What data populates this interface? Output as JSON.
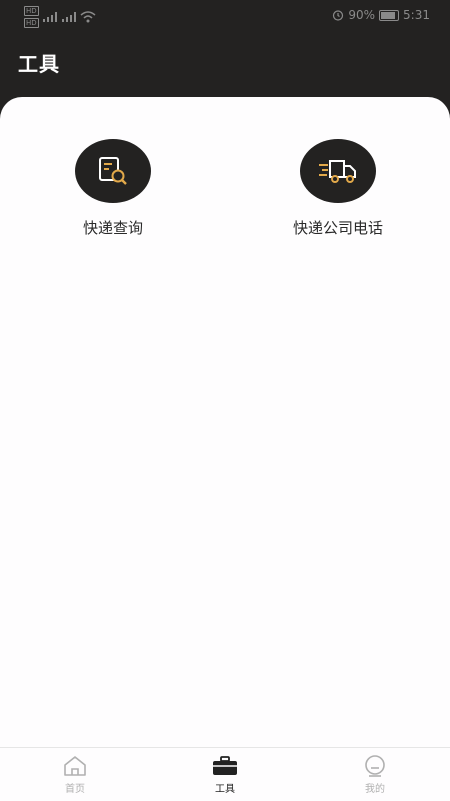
{
  "status_bar": {
    "hd_label": "HD",
    "battery_text": "90%",
    "time": "5:31"
  },
  "header": {
    "title": "工具"
  },
  "tools": [
    {
      "label": "快递查询",
      "icon": "document-search-icon"
    },
    {
      "label": "快递公司电话",
      "icon": "delivery-truck-icon"
    }
  ],
  "bottom_nav": {
    "items": [
      {
        "label": "首页",
        "icon": "home-icon",
        "active": false
      },
      {
        "label": "工具",
        "icon": "toolbox-icon",
        "active": true
      },
      {
        "label": "我的",
        "icon": "profile-icon",
        "active": false
      }
    ]
  },
  "colors": {
    "dark": "#232221",
    "accent": "#e2a94a",
    "card": "#fefdfe",
    "inactive": "#b0b0b0"
  }
}
